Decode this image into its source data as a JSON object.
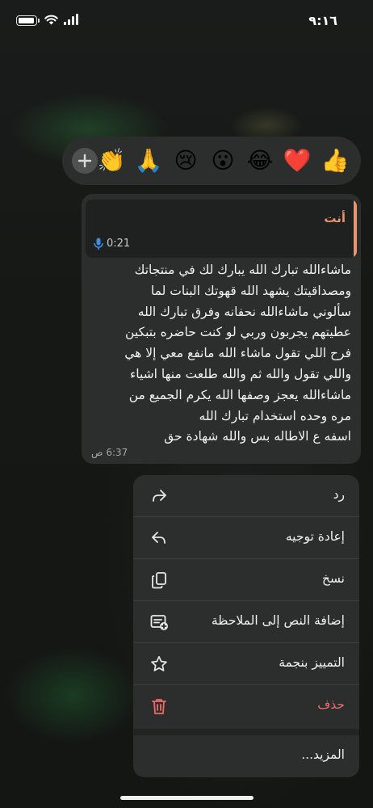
{
  "status_bar": {
    "time": "٩:١٦",
    "icons": [
      "battery-icon",
      "wifi-icon",
      "signal-icon"
    ]
  },
  "reactions": {
    "add_icon": "plus-icon",
    "items": [
      "👏",
      "🙏",
      "😢",
      "😮",
      "😂",
      "❤️",
      "👍"
    ]
  },
  "message": {
    "quote": {
      "author": "أنت",
      "type_icon": "mic-icon",
      "duration": "0:21"
    },
    "text": "ماشاءالله تبارك الله يبارك لك في منتجاتك\nومصداقيتك يشهد الله قهوتك البنات لما\nسألوني ماشاءالله نحفانه وفرق تبارك الله\nعطيتهم يجربون وربي لو كنت حاضره بتبكين\nفرح اللي تقول ماشاء الله مانفع معي إلا هي\nواللي تقول والله ثم والله طلعت منها اشياء\nماشاءالله يعجز وصفها الله يكرم الجميع من\nمره وحده استخدام تبارك الله\nاسفه ع الاطاله بس والله شهادة حق",
    "time": "6:37 ص"
  },
  "menu": {
    "items": [
      {
        "label": "رد",
        "icon": "reply-icon"
      },
      {
        "label": "إعادة توجيه",
        "icon": "forward-icon"
      },
      {
        "label": "نسخ",
        "icon": "copy-icon"
      },
      {
        "label": "إضافة النص إلى الملاحظة",
        "icon": "add-note-icon"
      },
      {
        "label": "التمييز بنجمة",
        "icon": "star-icon"
      },
      {
        "label": "حذف",
        "icon": "trash-icon"
      }
    ],
    "more": "المزيد..."
  },
  "colors": {
    "accent": "#e6956e",
    "danger": "#ef6b6b",
    "mic": "#3b8fe6",
    "surface": "#2c2e2d"
  }
}
